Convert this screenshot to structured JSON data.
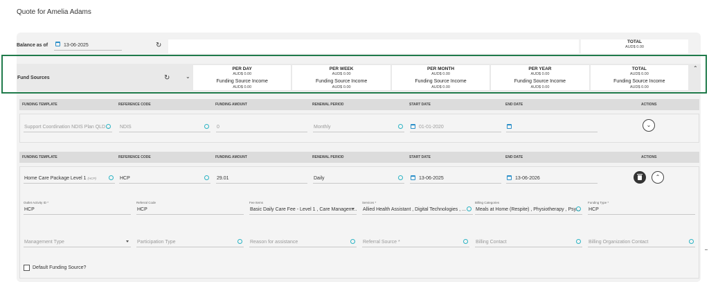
{
  "page_title": "Quote for Amelia Adams",
  "balance": {
    "label": "Balance as of",
    "date": "13-06-2025",
    "total_label": "TOTAL",
    "total_value": "AUD$ 0.00"
  },
  "fund_sources": {
    "label": "Fund Sources",
    "columns": [
      {
        "period": "PER DAY",
        "amount": "AUD$ 0.00",
        "income_label": "Funding Source Income",
        "income_value": "AUD$ 0.00"
      },
      {
        "period": "PER WEEK",
        "amount": "AUD$ 0.00",
        "income_label": "Funding Source Income",
        "income_value": "AUD$ 0.00"
      },
      {
        "period": "PER MONTH",
        "amount": "AUD$ 0.00",
        "income_label": "Funding Source Income",
        "income_value": "AUD$ 0.00"
      },
      {
        "period": "PER YEAR",
        "amount": "AUD$ 0.00",
        "income_label": "Funding Source Income",
        "income_value": "AUD$ 0.00"
      },
      {
        "period": "TOTAL",
        "amount": "AUD$ 0.00",
        "income_label": "Funding Source Income",
        "income_value": "AUD$ 0.00"
      }
    ]
  },
  "table_headers": {
    "funding_template": "FUNDING TEMPLATE",
    "reference_code": "REFERENCE CODE",
    "funding_amount": "FUNDING AMOUNT",
    "renewal_period": "RENEWAL PERIOD",
    "start_date": "START DATE",
    "end_date": "END DATE",
    "actions": "ACTIONS"
  },
  "row1": {
    "template": "Support Coordination NDIS Plan QLD ...",
    "reference": "NDIS",
    "amount": "0",
    "renewal": "Monthly",
    "start": "01-01-2020",
    "end": ""
  },
  "row2": {
    "template": "Home Care Package Level 1",
    "template_tag": "(HCP)",
    "reference": "HCP",
    "amount": "29.01",
    "renewal": "Daily",
    "start": "13-06-2025",
    "end": "13-06-2026"
  },
  "details": {
    "outlet_label": "Outlet Activity ID *",
    "outlet_value": "HCP",
    "referral_code_label": "Referral Code",
    "referral_code_value": "HCP",
    "fee_items_label": "Fee Items",
    "fee_items_value": "Basic Daily Care Fee - Level 1 , Care Managem...",
    "services_label": "Services *",
    "services_value": "Allied Health Assistant , Digital Technologies , ...",
    "billing_categories_label": "Billing Categories",
    "billing_categories_value": "Meals at Home (Respite) , Physiotherapy , Psy...",
    "funding_type_label": "Funding Type *",
    "funding_type_value": "HCP",
    "management_type": "Management Type",
    "participation_type": "Participation Type",
    "reason": "Reason for assistance",
    "referral_source": "Referral Source *",
    "billing_contact": "Billing Contact",
    "billing_org_contact": "Billing Organization Contact",
    "default_funding": "Default Funding Source?"
  }
}
